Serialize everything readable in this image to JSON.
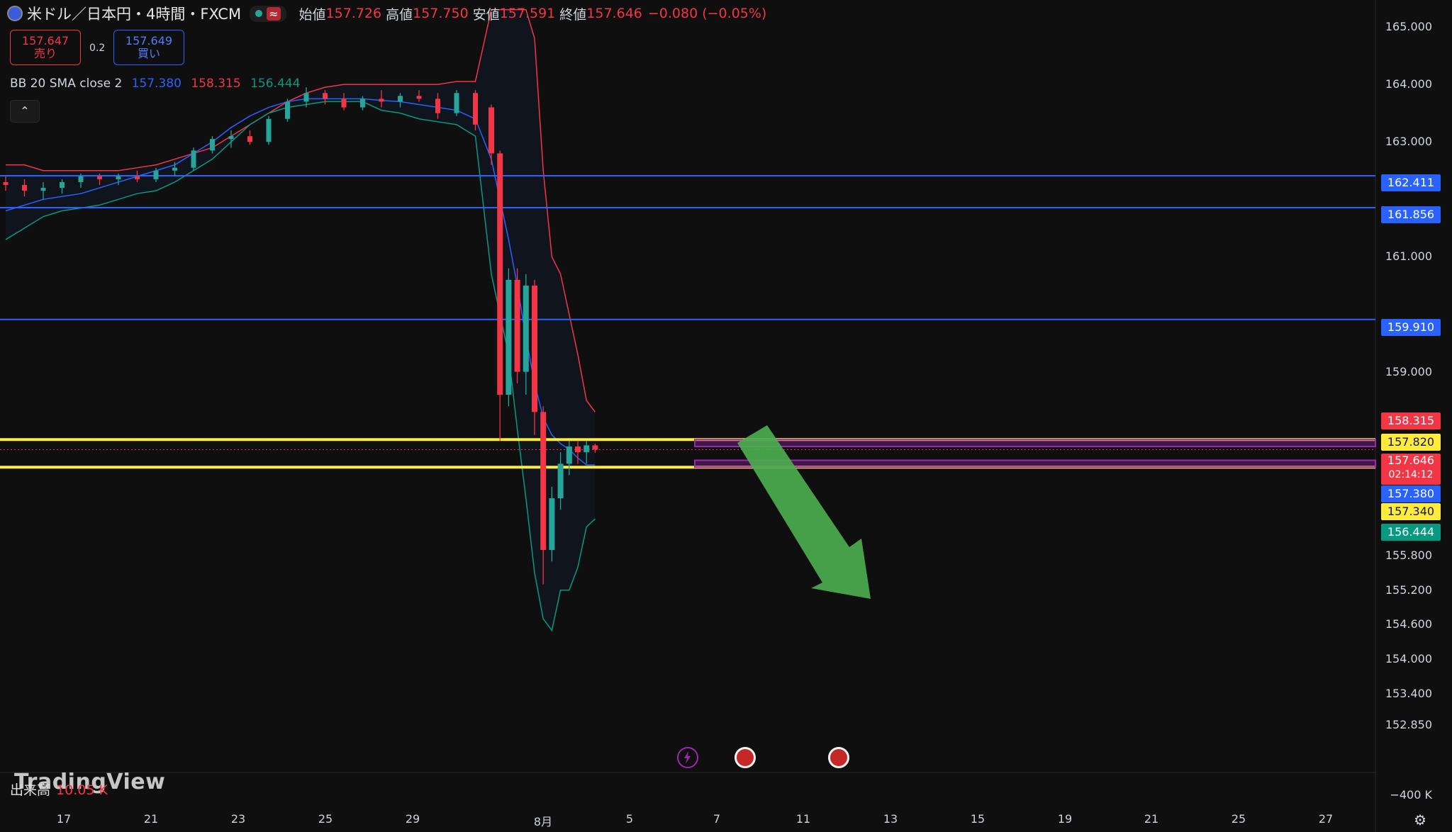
{
  "header": {
    "symbol": "米ドル／日本円・4時間・FXCM",
    "open_label": "始値",
    "open": "157.726",
    "high_label": "高値",
    "high": "157.750",
    "low_label": "安値",
    "low": "157.591",
    "close_label": "終値",
    "close": "157.646",
    "change": "−0.080 (−0.05%)",
    "icons": [
      "us-flag-icon",
      "market-open-dot-icon",
      "wave-icon"
    ]
  },
  "trade": {
    "sell_price": "157.647",
    "sell_label": "売り",
    "spread": "0.2",
    "buy_price": "157.649",
    "buy_label": "買い"
  },
  "indicator": {
    "name": "BB 20 SMA close 2",
    "basis": "157.380",
    "upper": "158.315",
    "lower": "156.444"
  },
  "volume": {
    "label": "出来高",
    "value": "10.05 K",
    "axis_tick": "−400 K"
  },
  "brand": "TradingView",
  "price_ticks": [
    "165.000",
    "164.000",
    "163.000",
    "161.000",
    "159.000",
    "155.800",
    "155.200",
    "154.600",
    "154.000",
    "153.400",
    "152.850"
  ],
  "price_tags": [
    {
      "text": "162.411",
      "color": "#2962ff"
    },
    {
      "text": "161.856",
      "color": "#2962ff"
    },
    {
      "text": "159.910",
      "color": "#2962ff"
    },
    {
      "text": "158.315",
      "color": "#f23645"
    },
    {
      "text": "157.820",
      "color": "#ffeb3b",
      "dark": true
    },
    {
      "text": "157.646",
      "color": "#f23645",
      "countdown": "02:14:12"
    },
    {
      "text": "157.380",
      "color": "#2962ff"
    },
    {
      "text": "157.340",
      "color": "#ffeb3b",
      "dark": true
    },
    {
      "text": "156.444",
      "color": "#089981"
    }
  ],
  "x_labels": [
    "17",
    "21",
    "23",
    "25",
    "29",
    "8月",
    "5",
    "7",
    "11",
    "13",
    "15",
    "19",
    "21",
    "25",
    "27"
  ],
  "colors": {
    "up": "#26a69a",
    "down": "#f23645",
    "basis": "#2962ff",
    "upper_band": "#f23645",
    "lower_band": "#089981",
    "hline": "#2962ff",
    "yellow": "#ffeb3b",
    "zone": "#9c27b0",
    "arrow": "#4caf50"
  },
  "chart_data": {
    "type": "candlestick",
    "title": "米ドル／日本円・4時間・FXCM",
    "price_range": [
      152.6,
      165.3
    ],
    "horizontal_levels": [
      162.411,
      161.856,
      159.91,
      157.82,
      157.34
    ],
    "resistance_zone": [
      157.7,
      157.82
    ],
    "support_zone": [
      157.34,
      157.46
    ],
    "annotation": "green arrow pointing down from ~157.7 toward ~155.2",
    "bollinger": {
      "upper": [
        162.6,
        162.6,
        162.5,
        162.5,
        162.5,
        162.5,
        162.5,
        162.55,
        162.6,
        162.7,
        162.8,
        162.9,
        163.1,
        163.3,
        163.5,
        163.7,
        163.85,
        163.95,
        164.0,
        164.0,
        164.0,
        164.0,
        164.0,
        164.0,
        164.05,
        164.05,
        165.3,
        165.3,
        165.3,
        165.3,
        165.3,
        164.8,
        162.5,
        161.0,
        160.7,
        160.0,
        159.3,
        158.5,
        158.3
      ],
      "basis": [
        161.8,
        161.9,
        162.0,
        162.05,
        162.1,
        162.2,
        162.3,
        162.4,
        162.5,
        162.6,
        162.8,
        163.0,
        163.25,
        163.45,
        163.6,
        163.7,
        163.75,
        163.75,
        163.75,
        163.75,
        163.72,
        163.7,
        163.65,
        163.6,
        163.55,
        163.4,
        162.7,
        162.0,
        161.3,
        160.5,
        159.6,
        158.8,
        158.2,
        157.9,
        157.75,
        157.65,
        157.5,
        157.38,
        157.38
      ],
      "lower": [
        161.3,
        161.5,
        161.7,
        161.8,
        161.85,
        161.9,
        162.0,
        162.1,
        162.15,
        162.3,
        162.5,
        162.7,
        163.0,
        163.3,
        163.5,
        163.6,
        163.65,
        163.7,
        163.7,
        163.7,
        163.55,
        163.5,
        163.4,
        163.35,
        163.3,
        163.1,
        160.7,
        160.0,
        159.3,
        158.0,
        156.8,
        155.5,
        154.7,
        154.5,
        155.2,
        155.2,
        155.6,
        156.3,
        156.44
      ]
    },
    "candles": [
      [
        162.3,
        162.4,
        162.15,
        162.25
      ],
      [
        162.25,
        162.35,
        162.05,
        162.15
      ],
      [
        162.15,
        162.3,
        162.0,
        162.2
      ],
      [
        162.2,
        162.35,
        162.1,
        162.3
      ],
      [
        162.3,
        162.45,
        162.2,
        162.4
      ],
      [
        162.4,
        162.45,
        162.25,
        162.35
      ],
      [
        162.35,
        162.45,
        162.25,
        162.4
      ],
      [
        162.4,
        162.5,
        162.3,
        162.35
      ],
      [
        162.35,
        162.55,
        162.3,
        162.5
      ],
      [
        162.5,
        162.65,
        162.4,
        162.55
      ],
      [
        162.55,
        162.9,
        162.5,
        162.85
      ],
      [
        162.85,
        163.1,
        162.8,
        163.05
      ],
      [
        163.05,
        163.2,
        162.9,
        163.1
      ],
      [
        163.1,
        163.2,
        162.95,
        163.0
      ],
      [
        163.0,
        163.45,
        162.95,
        163.4
      ],
      [
        163.4,
        163.75,
        163.35,
        163.7
      ],
      [
        163.7,
        163.95,
        163.6,
        163.85
      ],
      [
        163.85,
        163.9,
        163.65,
        163.75
      ],
      [
        163.75,
        163.85,
        163.55,
        163.6
      ],
      [
        163.6,
        163.8,
        163.55,
        163.75
      ],
      [
        163.75,
        163.9,
        163.6,
        163.7
      ],
      [
        163.7,
        163.85,
        163.6,
        163.8
      ],
      [
        163.8,
        163.9,
        163.7,
        163.75
      ],
      [
        163.75,
        163.85,
        163.4,
        163.5
      ],
      [
        163.5,
        163.9,
        163.45,
        163.85
      ],
      [
        163.85,
        163.9,
        163.2,
        163.3
      ],
      [
        163.6,
        163.65,
        162.6,
        162.8
      ],
      [
        162.8,
        162.85,
        157.8,
        158.6
      ],
      [
        158.6,
        160.8,
        158.4,
        160.6
      ],
      [
        160.6,
        160.8,
        158.8,
        159.0
      ],
      [
        159.0,
        160.7,
        158.6,
        160.5
      ],
      [
        160.5,
        160.6,
        157.9,
        158.3
      ],
      [
        158.3,
        158.4,
        155.3,
        155.9
      ],
      [
        155.9,
        157.0,
        155.7,
        156.8
      ],
      [
        156.8,
        157.6,
        156.6,
        157.4
      ],
      [
        157.4,
        157.8,
        157.2,
        157.7
      ],
      [
        157.7,
        157.8,
        157.4,
        157.6
      ],
      [
        157.6,
        157.8,
        157.4,
        157.72
      ],
      [
        157.72,
        157.75,
        157.59,
        157.646
      ]
    ]
  }
}
